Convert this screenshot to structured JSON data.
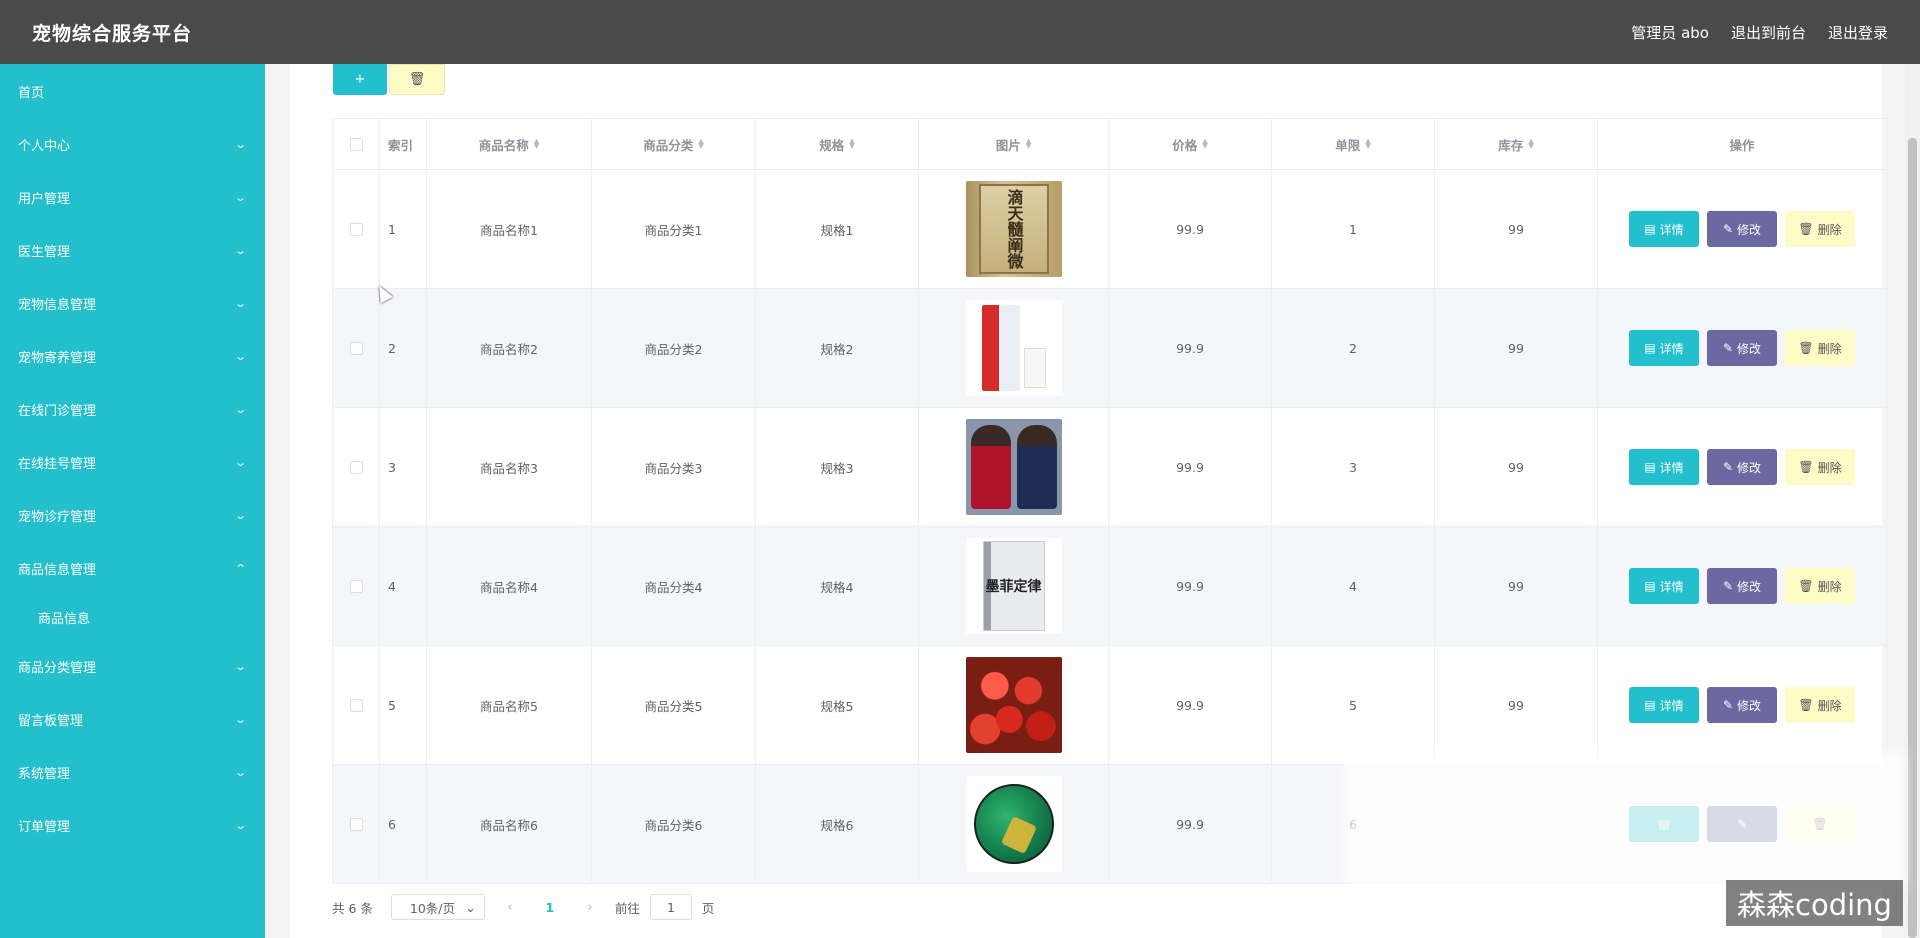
{
  "header": {
    "title": "宠物综合服务平台",
    "nav": [
      "管理员 abo",
      "退出到前台",
      "退出登录"
    ]
  },
  "sidebar": {
    "items": [
      {
        "label": "首页",
        "expandable": false
      },
      {
        "label": "个人中心",
        "expandable": true
      },
      {
        "label": "用户管理",
        "expandable": true
      },
      {
        "label": "医生管理",
        "expandable": true
      },
      {
        "label": "宠物信息管理",
        "expandable": true
      },
      {
        "label": "宠物寄养管理",
        "expandable": true
      },
      {
        "label": "在线门诊管理",
        "expandable": true
      },
      {
        "label": "在线挂号管理",
        "expandable": true
      },
      {
        "label": "宠物诊疗管理",
        "expandable": true
      },
      {
        "label": "商品信息管理",
        "expandable": true,
        "expanded": true
      },
      {
        "label": "商品分类管理",
        "expandable": true
      },
      {
        "label": "留言板管理",
        "expandable": true
      },
      {
        "label": "系统管理",
        "expandable": true
      },
      {
        "label": "订单管理",
        "expandable": true
      }
    ],
    "subitem": "商品信息"
  },
  "toolbar": {
    "add_label": "+",
    "delete_label": "🗑"
  },
  "table": {
    "headers": {
      "index": "索引",
      "name": "商品名称",
      "category": "商品分类",
      "spec": "规格",
      "image": "图片",
      "price": "价格",
      "limit": "单限",
      "stock": "库存",
      "ops": "操作"
    },
    "rows": [
      {
        "index": "1",
        "name": "商品名称1",
        "category": "商品分类1",
        "spec": "规格1",
        "image": "book",
        "price": "99.9",
        "limit": "1",
        "stock": "99"
      },
      {
        "index": "2",
        "name": "商品名称2",
        "category": "商品分类2",
        "spec": "规格2",
        "image": "milk",
        "price": "99.9",
        "limit": "2",
        "stock": "99"
      },
      {
        "index": "3",
        "name": "商品名称3",
        "category": "商品分类3",
        "spec": "规格3",
        "image": "dresses",
        "price": "99.9",
        "limit": "3",
        "stock": "99"
      },
      {
        "index": "4",
        "name": "商品名称4",
        "category": "商品分类4",
        "spec": "规格4",
        "image": "book",
        "price": "99.9",
        "limit": "4",
        "stock": "99"
      },
      {
        "index": "5",
        "name": "商品名称5",
        "category": "商品分类5",
        "spec": "规格5",
        "image": "cherries",
        "price": "99.9",
        "limit": "5",
        "stock": "99"
      },
      {
        "index": "6",
        "name": "商品名称6",
        "category": "商品分类6",
        "spec": "规格6",
        "image": "football",
        "price": "99.9",
        "limit": "6",
        "stock": ""
      }
    ],
    "ops": {
      "detail": "详情",
      "edit": "修改",
      "remove": "删除"
    }
  },
  "image_text": {
    "book1": "滴天髓阐微",
    "book4": "墨菲定律"
  },
  "pagination": {
    "total": "共 6 条",
    "page_size": "10条/页",
    "current_page": "1",
    "goto_prefix": "前往",
    "goto_value": "1",
    "goto_suffix": "页"
  },
  "watermark": "森森coding",
  "colors": {
    "header_bg": "#4a4a4a",
    "sidebar_bg": "#23bfcc",
    "accent": "#23bfcc",
    "edit_button": "#6c68a2",
    "delete_button": "#fdfbc6"
  }
}
